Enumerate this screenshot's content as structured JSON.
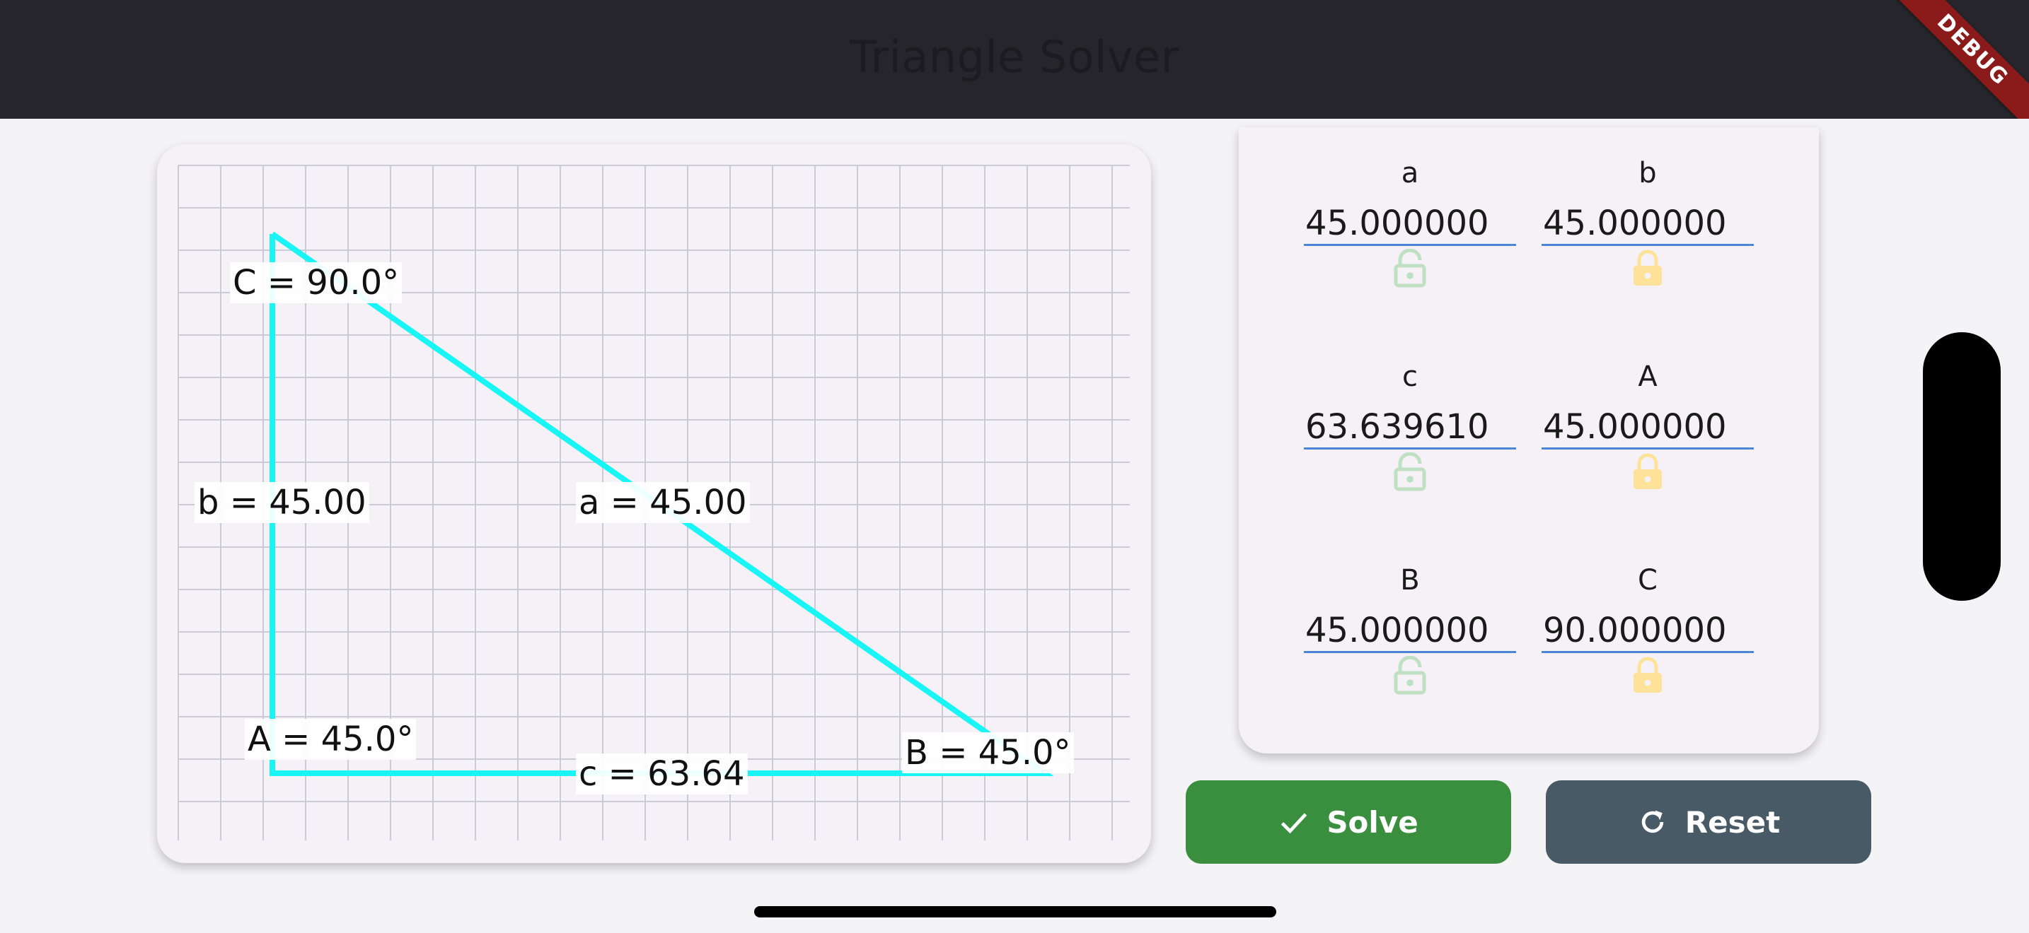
{
  "app": {
    "title": "Triangle Solver",
    "debug_badge": "DEBUG"
  },
  "colors": {
    "appbar": "#25252b",
    "triangle_stroke": "#19f5f5",
    "lock_unlocked": "#bfe0c3",
    "lock_locked": "#ffe29a",
    "solve_button": "#3a8f3e",
    "reset_button": "#485a66",
    "input_underline": "#4a86d8"
  },
  "triangle": {
    "labels": {
      "angle_C": "C = 90.0°",
      "angle_A": "A = 45.0°",
      "angle_B": "B = 45.0°",
      "side_a": "a = 45.00",
      "side_b": "b = 45.00",
      "side_c": "c = 63.64"
    }
  },
  "form": {
    "fields": [
      {
        "label": "a",
        "value": "45.000000",
        "lock": "unlocked"
      },
      {
        "label": "b",
        "value": "45.000000",
        "lock": "locked"
      },
      {
        "label": "c",
        "value": "63.639610",
        "lock": "unlocked"
      },
      {
        "label": "A",
        "value": "45.000000",
        "lock": "locked"
      },
      {
        "label": "B",
        "value": "45.000000",
        "lock": "unlocked"
      },
      {
        "label": "C",
        "value": "90.000000",
        "lock": "locked"
      }
    ]
  },
  "actions": {
    "solve_label": "Solve",
    "solve_icon": "check-icon",
    "reset_label": "Reset",
    "reset_icon": "refresh-icon"
  }
}
